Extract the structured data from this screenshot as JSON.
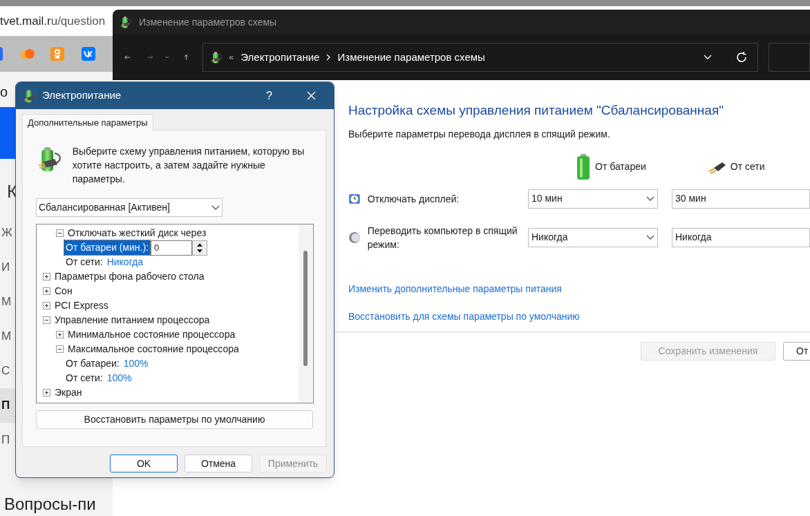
{
  "browser": {
    "address": "tvet.mail.ru/question",
    "header_fragment": "о",
    "title_fragment": "К",
    "sidebar": [
      {
        "label": "Ж",
        "selected": false
      },
      {
        "label": "И",
        "selected": false
      },
      {
        "label": "М",
        "selected": false
      },
      {
        "label": "М",
        "selected": false
      },
      {
        "label": "С",
        "selected": false
      },
      {
        "label": "П",
        "selected": true
      },
      {
        "label": "П",
        "selected": false
      }
    ],
    "heading": "Вопросы-пи"
  },
  "control_panel": {
    "title": "Изменение параметров схемы",
    "separator": "«",
    "breadcrumbs": [
      "Электропитание",
      "Изменение параметров схемы"
    ],
    "heading": "Настройка схемы управления питанием \"Сбалансированная\"",
    "subtitle": "Выберите параметры перевода дисплея в спящий режим.",
    "columns": [
      "От батареи",
      "От сети"
    ],
    "settings": [
      {
        "kind": "display",
        "label": "Отключать дисплей:",
        "battery": "10 мин",
        "plugged": "30 мин"
      },
      {
        "kind": "sleep",
        "label": "Переводить компьютер в спящий режим:",
        "battery": "Никогда",
        "plugged": "Никогда"
      }
    ],
    "links": [
      "Изменить дополнительные параметры питания",
      "Восстановить для схемы параметры по умолчанию"
    ],
    "buttons": [
      {
        "label": "Сохранить изменения",
        "disabled": true
      },
      {
        "label": "От",
        "disabled": false
      }
    ]
  },
  "dialog": {
    "title": "Электропитание",
    "help": "?",
    "tab": {
      "label": "Дополнительные параметры",
      "selected": true
    },
    "description": "Выберите схему управления питанием, которую вы хотите настроить, а затем задайте нужные параметры.",
    "scheme": "Сбалансированная [Активен]",
    "tree": [
      {
        "children": [
          {
            "label": "Отключать жесткий диск через",
            "expanded": true,
            "children": [
              {
                "kind": "spin",
                "label": "От батареи (мин.):",
                "value": "0",
                "selected": true
              },
              {
                "kind": "value",
                "label": "От сети:",
                "value": "Никогда",
                "selected": false
              }
            ]
          }
        ]
      },
      {
        "label": "Параметры фона рабочего стола",
        "expanded": false
      },
      {
        "label": "Сон",
        "expanded": false
      },
      {
        "label": "PCI Express",
        "expanded": false
      },
      {
        "label": "Управление питанием процессора",
        "expanded": true,
        "children": [
          {
            "label": "Минимальное состояние процессора",
            "expanded": false
          },
          {
            "label": "Максимальное состояние процессора",
            "expanded": true,
            "children": [
              {
                "kind": "value",
                "label": "От батареи:",
                "value": "100%",
                "selected": false
              },
              {
                "kind": "value",
                "label": "От сети:",
                "value": "100%",
                "selected": false
              }
            ]
          }
        ]
      },
      {
        "label": "Экран",
        "expanded": false
      }
    ],
    "restore_button": "Восстановить параметры по умолчанию",
    "buttons": [
      {
        "label": "OK",
        "default": true,
        "disabled": false
      },
      {
        "label": "Отмена",
        "default": false,
        "disabled": false
      },
      {
        "label": "Применить",
        "default": false,
        "disabled": true
      }
    ]
  }
}
